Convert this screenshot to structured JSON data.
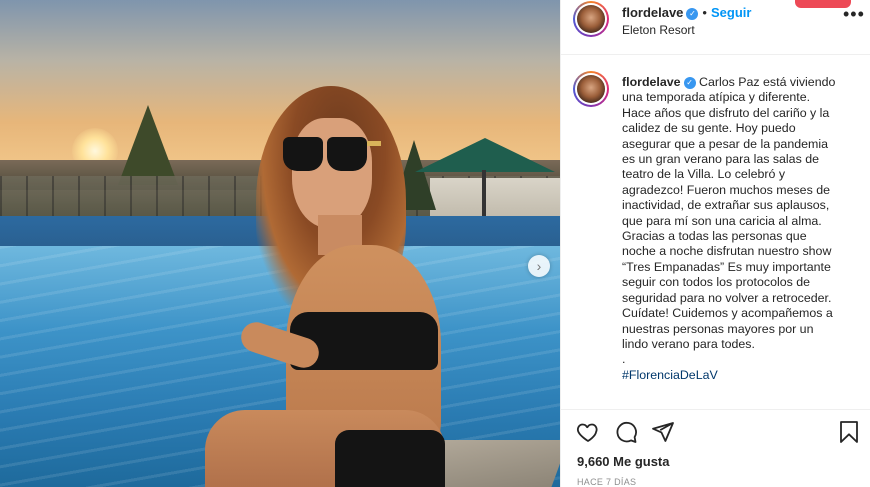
{
  "post": {
    "username": "flordelave",
    "verified_mark": "✓",
    "separator": "•",
    "follow_label": "Seguir",
    "location": "Eleton Resort",
    "more_label": "•••",
    "next_label": "›",
    "caption_lines": [
      "Carlos Paz está viviendo",
      "una temporada atípica y diferente.",
      "Hace años que disfruto del cariño y la",
      "calidez de su gente. Hoy puedo",
      "asegurar que a pesar de la pandemia",
      "es un gran verano para las salas de",
      "teatro de la Villa. Lo celebró y",
      "agradezco! Fueron muchos meses de",
      "inactividad, de extrañar sus aplausos,",
      "que para mí son una caricia al alma.",
      "Gracias a todas las personas que",
      "noche a noche disfrutan nuestro show",
      "“Tres Empanadas” Es muy importante",
      "seguir con todos los protocolos de",
      "seguridad para no volver a retroceder.",
      "Cuídate! Cuidemos y acompañemos a",
      "nuestras personas mayores por un",
      "lindo verano para todes.",
      "."
    ],
    "hashtag": "#FlorenciaDeLaV",
    "likes": "9,660 Me gusta",
    "date": "HACE 7 DÍAS"
  },
  "icons": {
    "like": "heart-icon",
    "comment": "comment-icon",
    "share": "paper-plane-icon",
    "save": "bookmark-icon",
    "verified": "verified-badge-icon",
    "next": "chevron-right-icon",
    "more": "more-options-icon"
  },
  "colors": {
    "link_blue": "#0095f6",
    "verified_blue": "#3897f0",
    "hashtag": "#00376b",
    "text": "#262626",
    "muted": "#8e8e8e",
    "notification_red": "#ed4956"
  }
}
